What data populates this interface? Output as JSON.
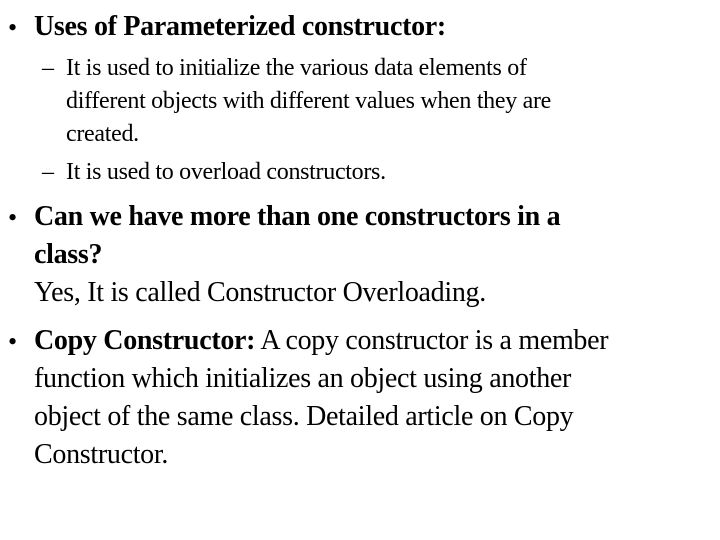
{
  "slide": {
    "bullets": [
      {
        "marker": "•",
        "heading": "Uses of Parameterized constructor:",
        "sub_items": [
          {
            "marker": "–",
            "lines": [
              "It is used to initialize the various data elements of",
              "different objects with different values when they are",
              "created."
            ]
          },
          {
            "marker": "–",
            "lines": [
              "It is used to overload constructors."
            ]
          }
        ]
      },
      {
        "marker": "•",
        "heading_lines": [
          "Can we have more than one constructors in a",
          "class?"
        ],
        "answer": "Yes, It is called Constructor Overloading."
      },
      {
        "marker": "•",
        "heading": "Copy Constructor:",
        "lines": [
          " A copy constructor is a member",
          "function which initializes an object using another",
          "object of the same class. Detailed article on Copy",
          "Constructor."
        ]
      }
    ]
  }
}
